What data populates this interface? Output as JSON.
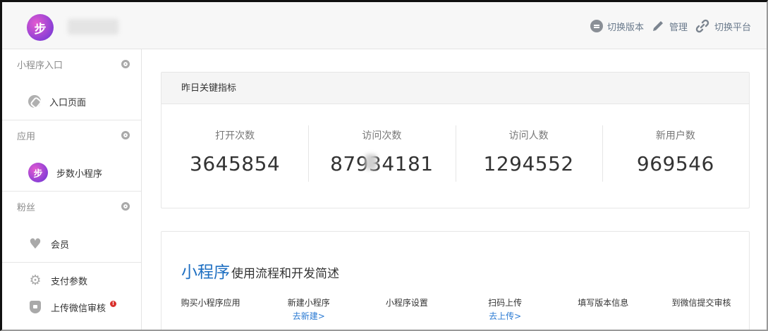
{
  "header": {
    "logo_char": "步",
    "actions": [
      {
        "label": "切换版本",
        "icon": "circle-equals-icon"
      },
      {
        "label": "管理",
        "icon": "pencil-icon"
      },
      {
        "label": "切换平台",
        "icon": "link-icon"
      }
    ]
  },
  "sidebar": {
    "groups": [
      {
        "title": "小程序入口",
        "items": [
          {
            "label": "入口页面",
            "icon": "link-icon"
          }
        ]
      },
      {
        "title": "应用",
        "items": [
          {
            "label": "步数小程序",
            "icon": "app-logo-icon",
            "icon_char": "步"
          }
        ]
      },
      {
        "title": "粉丝",
        "items": [
          {
            "label": "会员",
            "icon": "heart-icon"
          }
        ]
      }
    ],
    "extra_items": [
      {
        "label": "支付参数",
        "icon": "gear-icon"
      },
      {
        "label": "上传微信审核",
        "icon": "shield-icon",
        "badge": "!"
      }
    ]
  },
  "metrics_card": {
    "title": "昨日关键指标",
    "metrics": [
      {
        "label": "打开次数",
        "value": "3645854"
      },
      {
        "label": "访问次数",
        "value": "87934181"
      },
      {
        "label": "访问人数",
        "value": "1294552"
      },
      {
        "label": "新用户数",
        "value": "969546"
      }
    ]
  },
  "flow_card": {
    "title_main": "小程序",
    "title_sub": "使用流程和开发简述",
    "steps": [
      {
        "label": "购买小程序应用",
        "link": ""
      },
      {
        "label": "新建小程序",
        "link": "去新建>"
      },
      {
        "label": "小程序设置",
        "link": ""
      },
      {
        "label": "扫码上传",
        "link": "去上传>"
      },
      {
        "label": "填写版本信息",
        "link": ""
      },
      {
        "label": "到微信提交审核",
        "link": ""
      }
    ]
  },
  "colors": {
    "accent_blue": "#1e6fc2",
    "link_blue": "#2a7ad3",
    "logo_purple": "#8b3fd6",
    "badge_red": "#d9302c"
  }
}
